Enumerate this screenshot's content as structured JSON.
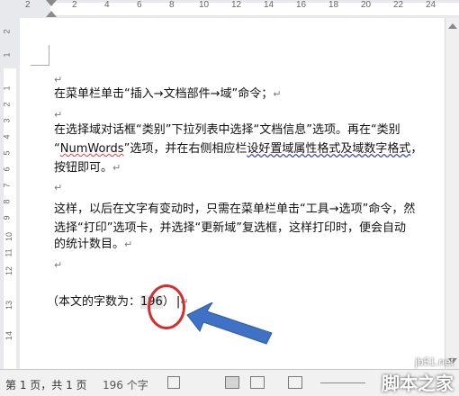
{
  "ruler": {
    "top_ticks": [
      "2",
      "2",
      "4",
      "6",
      "8",
      "10",
      "12",
      "14",
      "16",
      "18",
      "20",
      "22",
      "24"
    ],
    "left_ticks": [
      "2",
      "1",
      "1",
      "2",
      "3",
      "4",
      "5",
      "6",
      "7",
      "8",
      "9",
      "10",
      "11",
      "12",
      "13",
      "14"
    ]
  },
  "document": {
    "p1": "在菜单栏单击“插入→文档部件→域”命令；",
    "p2_line1": "在选择域对话框“类别”下拉列表中选择“文档信息”选项。再在“类别",
    "p2_line2_pre": "“",
    "p2_line2_word": "NumWords",
    "p2_line2_mid": "”选项，并在右侧相应栏",
    "p2_line2_squig": "设好置域属性格式及域数字格式",
    "p2_line2_end": "，",
    "p2_line3": "按钮即可。",
    "p3_line1": "这样，以后在文字有变动时，只需在菜单栏单击“工具→选项”命令，然",
    "p3_line2": "选择“打印”选项卡，并选择“更新域”复选框，这样打印时，便会自动",
    "p3_line3": "的统计数目。",
    "p4_prefix": "（本文的字数为：",
    "p4_field": "196",
    "p4_suffix": "）",
    "para_mark": "↵",
    "cursor_mark": "|"
  },
  "statusbar": {
    "page": "第 1 页，共 1 页",
    "words": "196 个字"
  },
  "watermark": {
    "site": "jb51.net",
    "name": "脚本之家"
  },
  "colors": {
    "annotation_red": "#d32f2f",
    "arrow_blue": "#3f72c4"
  }
}
